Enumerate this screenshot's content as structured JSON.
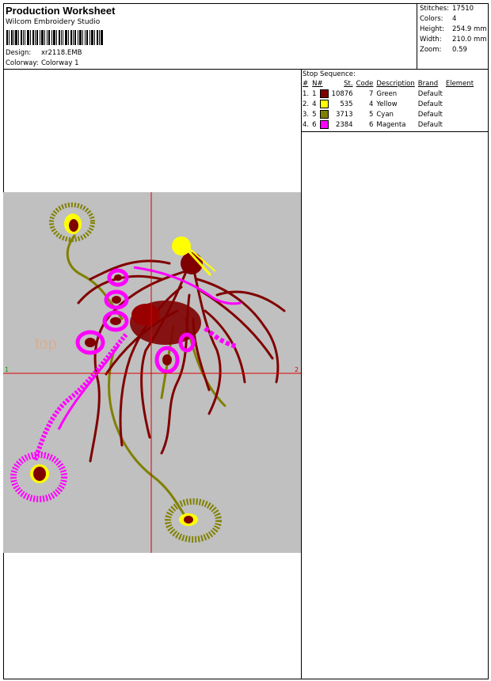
{
  "header": {
    "title": "Production Worksheet",
    "software": "Wilcom Embroidery Studio",
    "design_label": "Design:",
    "design_value": "xr2118.EMB",
    "colorway_label": "Colorway:",
    "colorway_value": "Colorway 1"
  },
  "stats": [
    {
      "label": "Stitches:",
      "value": "17510"
    },
    {
      "label": "Colors:",
      "value": "4"
    },
    {
      "label": "Height:",
      "value": "254.9 mm"
    },
    {
      "label": "Width:",
      "value": "210.0 mm"
    },
    {
      "label": "Zoom:",
      "value": "0.59"
    }
  ],
  "stop_sequence": {
    "title": "Stop Sequence:",
    "columns": [
      "#",
      "N#",
      "St.",
      "Code",
      "Description",
      "Brand",
      "Element"
    ],
    "rows": [
      {
        "num": "1.",
        "needle": "1",
        "color": "#800000",
        "stitches": "10876",
        "code": "7",
        "description": "Green",
        "brand": "Default"
      },
      {
        "num": "2.",
        "needle": "4",
        "color": "#ffff00",
        "stitches": "535",
        "code": "4",
        "description": "Yellow",
        "brand": "Default"
      },
      {
        "num": "3.",
        "needle": "5",
        "color": "#808000",
        "stitches": "3713",
        "code": "5",
        "description": "Cyan",
        "brand": "Default"
      },
      {
        "num": "4.",
        "needle": "6",
        "color": "#ff00ff",
        "stitches": "2384",
        "code": "6",
        "description": "Magenta",
        "brand": "Default"
      }
    ]
  },
  "preview": {
    "background": "#c0c0c0",
    "crosshair_color": "#e00000",
    "axis_marker_left": "1",
    "axis_marker_right": "2",
    "watermark": "top"
  }
}
